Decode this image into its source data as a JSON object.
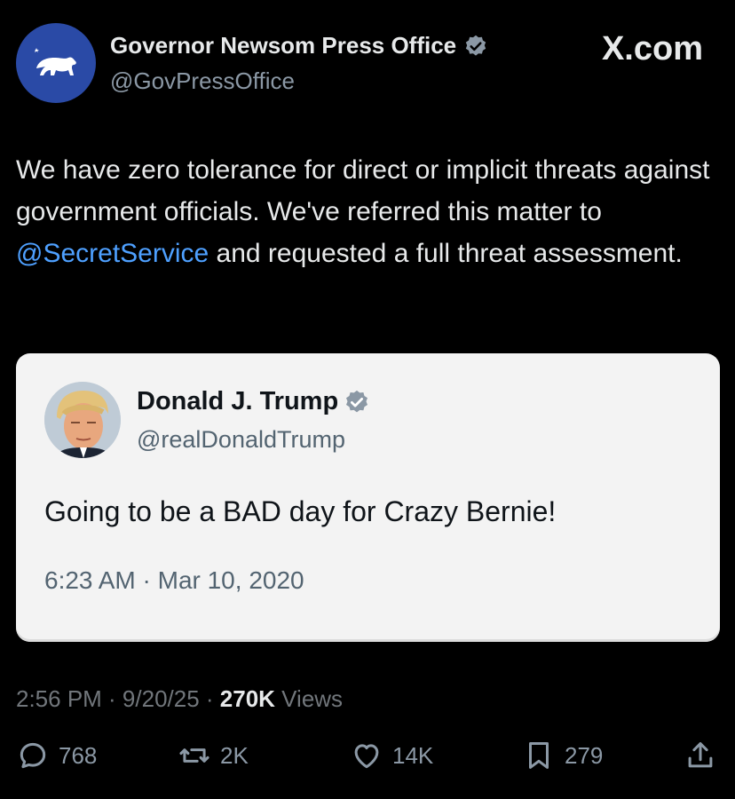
{
  "header": {
    "display_name": "Governor Newsom Press Office",
    "handle": "@GovPressOffice",
    "brand": "X.com"
  },
  "tweet": {
    "text_part1": "We have zero tolerance for direct or implicit threats against government officials. We've referred this matter to ",
    "mention": "@SecretService",
    "text_part2": " and requested a full threat assessment."
  },
  "quoted": {
    "display_name": "Donald J. Trump",
    "handle": "@realDonaldTrump",
    "text": "Going to be a BAD day for Crazy Bernie!",
    "timestamp": "6:23 AM · Mar 10, 2020"
  },
  "meta": {
    "time": "2:56 PM · 9/20/25 · ",
    "views_count": "270K",
    "views_label": " Views"
  },
  "actions": {
    "replies": "768",
    "reposts": "2K",
    "likes": "14K",
    "bookmarks": "279"
  },
  "colors": {
    "mention": "#4ea0ff",
    "verified": "#8b98a5",
    "gov_avatar": "#2a4aa6"
  }
}
